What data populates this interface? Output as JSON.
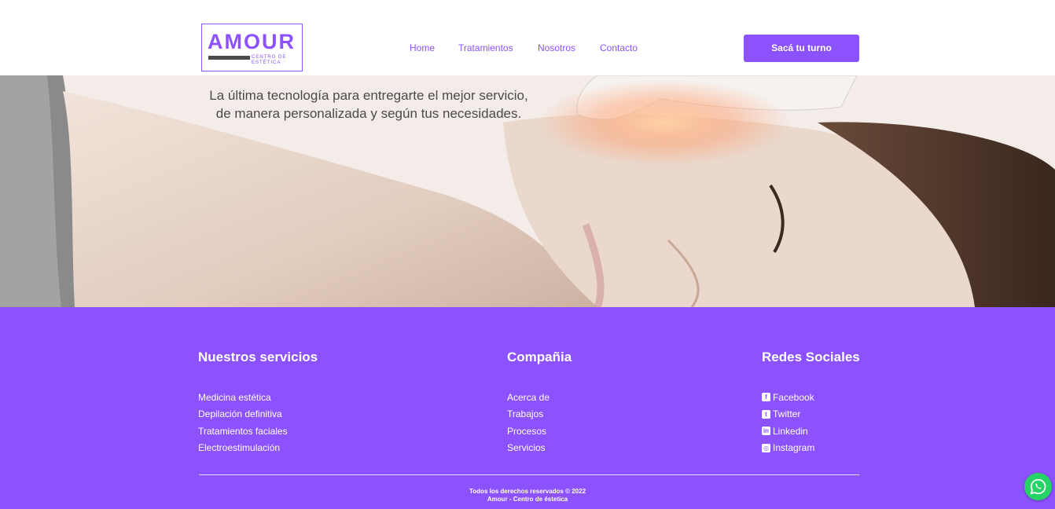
{
  "brand": {
    "logo_word": "AMOUR",
    "logo_sub": "CENTRO DE ESTÉTICA",
    "accent_color": "#8c52ff"
  },
  "nav": {
    "items": [
      {
        "label": "Home"
      },
      {
        "label": "Tratamientos"
      },
      {
        "label": "Nosotros"
      },
      {
        "label": "Contacto"
      }
    ],
    "cta_label": "Sacá tu turno"
  },
  "hero": {
    "line1": "La última tecnología para entregarte el mejor servicio,",
    "line2": "de manera personalizada y según tus necesidades."
  },
  "footer": {
    "services": {
      "title": "Nuestros servicios",
      "items": [
        "Medicina estética",
        "Depilación definitiva",
        "Tratamientos faciales",
        "Electroestimulación"
      ]
    },
    "company": {
      "title": "Compañia",
      "items": [
        "Acerca de",
        "Trabajos",
        "Procesos",
        "Servicios"
      ]
    },
    "social": {
      "title": "Redes Sociales",
      "items": [
        {
          "label": "Facebook",
          "icon": "facebook-icon"
        },
        {
          "label": "Twitter",
          "icon": "twitter-icon"
        },
        {
          "label": "Linkedin",
          "icon": "linkedin-icon"
        },
        {
          "label": "Instagram",
          "icon": "instagram-icon"
        }
      ]
    },
    "copyright_line1": "Todos los derechos reservados © 2022",
    "copyright_line2": "Amour - Centro de éstetica"
  },
  "whatsapp": {
    "icon": "whatsapp-icon",
    "color": "#25d366"
  }
}
